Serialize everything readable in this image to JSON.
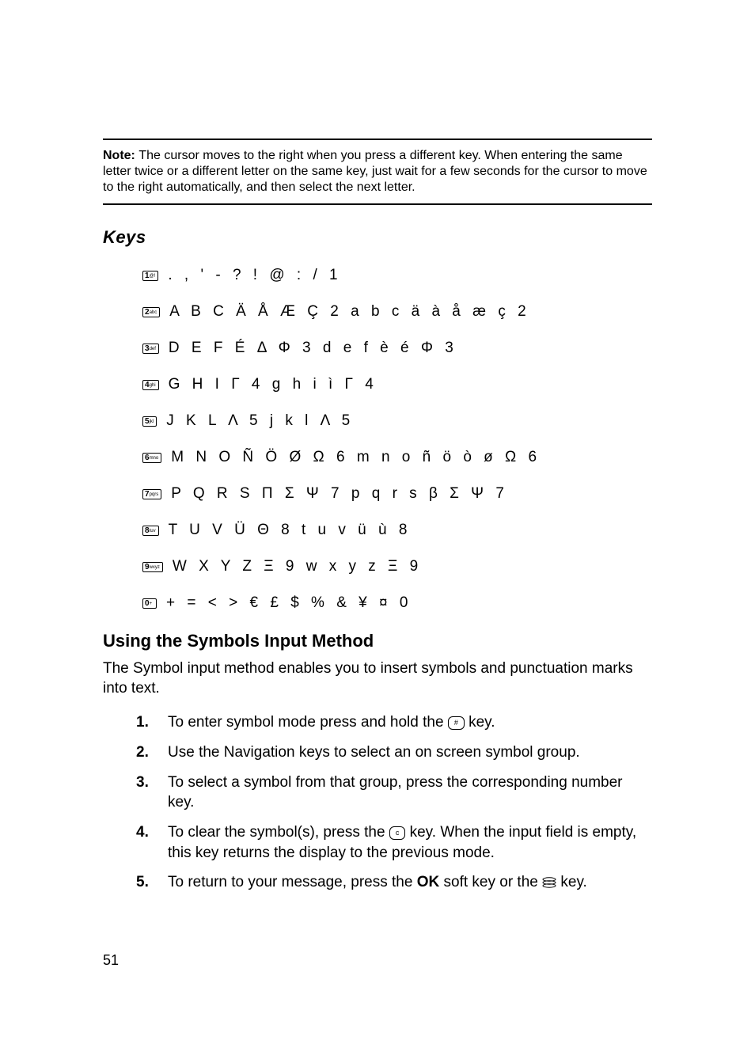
{
  "note": {
    "label": "Note:",
    "text": "The cursor moves to the right when you press a different key. When entering the same letter twice or a different letter on the same key, just wait for a few seconds for the cursor to move to the right automatically, and then select the next letter."
  },
  "section_keys_title": "Keys",
  "keys": [
    {
      "cap_main": "1",
      "cap_sub": "@!",
      "chars": ". , ' - ? ! @ : / 1"
    },
    {
      "cap_main": "2",
      "cap_sub": "abc",
      "chars": "A B C Ä Å Æ Ç 2 a b c ä à å æ ç 2"
    },
    {
      "cap_main": "3",
      "cap_sub": "def",
      "chars": "D E F É Δ Φ 3 d e f è é Φ 3"
    },
    {
      "cap_main": "4",
      "cap_sub": "ghi",
      "chars": "G H I Γ 4 g h i ì Γ 4"
    },
    {
      "cap_main": "5",
      "cap_sub": "jkl",
      "chars": "J K L Λ 5 j k l Λ 5"
    },
    {
      "cap_main": "6",
      "cap_sub": "mno",
      "chars": "M N O Ñ Ö Ø Ω 6 m n o ñ ö ò ø Ω 6"
    },
    {
      "cap_main": "7",
      "cap_sub": "pqrs",
      "chars": "P Q R S Π Σ Ψ 7 p q r s β Σ Ψ 7"
    },
    {
      "cap_main": "8",
      "cap_sub": "tuv",
      "chars": "T U V Ü Θ 8 t u v ü ù 8"
    },
    {
      "cap_main": "9",
      "cap_sub": "wxyz",
      "chars": "W X Y Z Ξ 9 w x y z Ξ 9"
    },
    {
      "cap_main": "0",
      "cap_sub": "+",
      "chars": "+ = < > € £ $ % & ¥ ¤ 0"
    }
  ],
  "section_symbols_title": "Using the Symbols Input Method",
  "symbols_intro": "The Symbol input method enables you to insert symbols and punctuation marks into text.",
  "steps": {
    "s1_a": "To enter symbol mode press and hold the ",
    "s1_b": " key.",
    "s2": "Use the Navigation keys to select an on screen symbol group.",
    "s3": "To select a symbol from that group, press the corresponding number key.",
    "s4_a": "To clear the symbol(s), press the ",
    "s4_b": " key. When the input field is empty, this key returns the display to the previous mode.",
    "s5_a": "To return to your message, press the ",
    "s5_ok": "OK",
    "s5_b": " soft key or the ",
    "s5_c": " key."
  },
  "page_number": "51"
}
